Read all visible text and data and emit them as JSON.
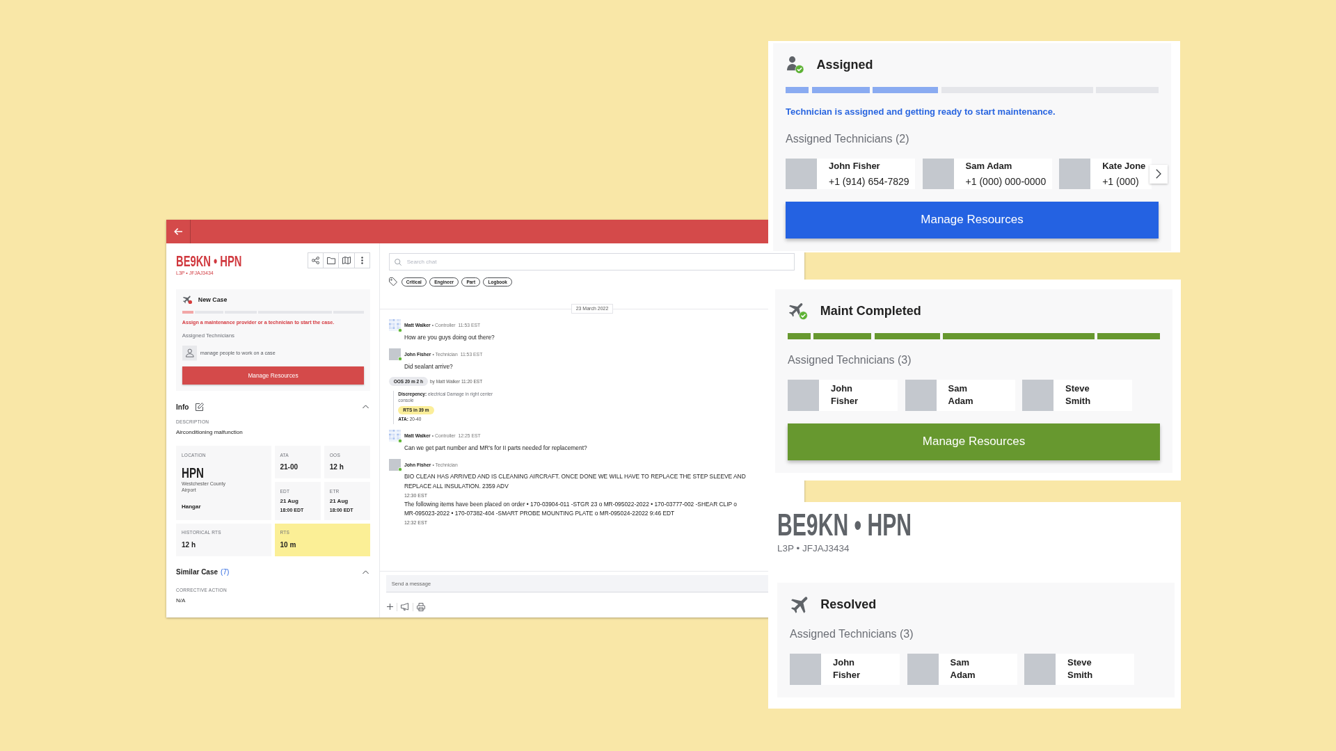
{
  "case_window": {
    "title": "BE9KN • HPN",
    "subtitle": "L3P • JFJAJ3434",
    "status": {
      "kind": "new_case",
      "title": "New Case",
      "steps": [
        {
          "done": true
        },
        {
          "done": false
        },
        {
          "done": false
        },
        {
          "done": false
        },
        {
          "done": false
        }
      ],
      "message": "Assign a maintenance provider or a technician to start the case.",
      "technicians_label": "Assigned Technicians",
      "empty_hint": "manage people to work on a case",
      "button": "Manage Resources"
    },
    "info": {
      "title": "Info",
      "expanded": true,
      "description_label": "DESCRIPTION",
      "description": "Airconditioning malfunction",
      "location": {
        "label": "LOCATION",
        "code": "HPN",
        "airport": "Westchester County Airport",
        "place": "Hangar"
      },
      "stats": [
        {
          "label": "ATA",
          "value": "21-00",
          "highlighted": false
        },
        {
          "label": "OOS",
          "value": "12 h",
          "highlighted": false
        },
        {
          "label": "EDT",
          "value": "21 Aug",
          "time": "18:00 EDT",
          "highlighted": false
        },
        {
          "label": "ETR",
          "value": "21 Aug",
          "time": "18:00 EDT",
          "highlighted": false
        },
        {
          "label": "HISTORICAL RTS",
          "value": "12 h",
          "highlighted": false
        },
        {
          "label": "RTS",
          "value": "10 m",
          "highlighted": true
        }
      ]
    },
    "similar_case": {
      "title": "Similar Case",
      "count": "(7)",
      "expanded": true,
      "field_label": "CORRECTIVE ACTION",
      "field_value": "N/A"
    }
  },
  "chat": {
    "search": {
      "placeholder": "Search chat"
    },
    "tags": [
      "Critical",
      "Engineer",
      "Part",
      "Logbook"
    ],
    "date": "23 March 2022",
    "items": [
      {
        "kind": "message",
        "avatar": {
          "kind": "pattern"
        },
        "online": true,
        "author": "Matt Walker",
        "role": "• Controller",
        "time": "11:53 EST",
        "paragraphs": [
          {
            "text": "How are you guys doing out there?"
          }
        ]
      },
      {
        "kind": "message",
        "avatar": {
          "kind": "photo"
        },
        "online": true,
        "author": "John Fisher",
        "role": "• Technician",
        "time": "11:53 EST",
        "paragraphs": [
          {
            "text": "Did sealant arrive?"
          }
        ]
      },
      {
        "kind": "event",
        "badge": "OOS 20 m 2 h",
        "meta": "by Matt Walker 11:20 EST",
        "discrepancy": "**Discrepency:** electrical Damage in right center console",
        "rts_badge": "RTS in 39 m",
        "ata": "**ATA:** 20-40"
      },
      {
        "kind": "message",
        "avatar": {
          "kind": "pattern"
        },
        "online": true,
        "author": "Matt Walker",
        "role": "• Controller",
        "time": "12:25 EST",
        "paragraphs": [
          {
            "text": "Can we get part number and MR's for II parts needed for replacement?"
          }
        ]
      },
      {
        "kind": "message",
        "avatar": {
          "kind": "photo"
        },
        "online": true,
        "author": "John Fisher",
        "role": "• Technician",
        "paragraphs": [
          {
            "text": "BIO CLEAN HAS ARRIVED AND IS CLEANING AIRCRAFT. ONCE DONE WE WILL HAVE TO REPLACE THE STEP SLEEVE AND REPLACE ALL INSULATION. 2359 ADV",
            "time": "12:30 EST"
          },
          {
            "text": "The following items have been placed on order • 170-03904-011 -STGR 23 o MR-095022-2022 • 170-03777-002 -SHEAR CLIP o MR-095023-2022 • 170-07382-404 -SMART PROBE MOUNTING PLATE o MR-095024-22022 9:46 EDT",
            "time": "12:32 EST"
          }
        ]
      }
    ],
    "composer": {
      "placeholder": "Send a message"
    }
  },
  "status_panels": [
    {
      "kind": "assigned",
      "title": "Assigned",
      "steps": [
        {
          "done": true
        },
        {
          "done": true
        },
        {
          "done": true
        },
        {
          "done": false
        },
        {
          "done": false
        }
      ],
      "message": "Technician is assigned and getting ready to start maintenance.",
      "technicians_label": "Assigned Technicians (2)",
      "technicians": [
        {
          "name": "John Fisher",
          "phone": "+1 (914) 654-7829"
        },
        {
          "name": "Sam Adam",
          "phone": "+1 (000) 000-0000"
        },
        {
          "name": "Kate Jone",
          "phone": "+1 (000)"
        }
      ],
      "more_button": true,
      "button": "Manage Resources"
    },
    {
      "kind": "maint_completed",
      "title": "Maint Completed",
      "steps": [
        {
          "done": true
        },
        {
          "done": true
        },
        {
          "done": true
        },
        {
          "done": true
        },
        {
          "done": true
        }
      ],
      "technicians_label": "Assigned Technicians (3)",
      "technicians": [
        {
          "name": "John Fisher"
        },
        {
          "name": "Sam Adam"
        },
        {
          "name": "Steve Smith"
        }
      ],
      "more_button": false,
      "button": "Manage Resources"
    },
    {
      "kind": "resolved",
      "header": {
        "title": "BE9KN • HPN",
        "subtitle": "L3P • JFJAJ3434"
      },
      "title": "Resolved",
      "technicians_label": "Assigned Technicians (3)",
      "technicians": [
        {
          "name": "John Fisher"
        },
        {
          "name": "Sam Adam"
        },
        {
          "name": "Steve Smith"
        }
      ],
      "more_button": false
    }
  ]
}
